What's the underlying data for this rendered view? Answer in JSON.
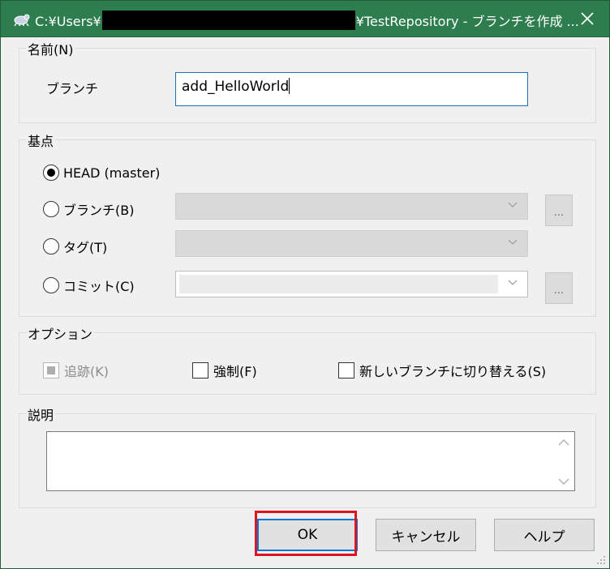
{
  "window": {
    "title_prefix": "C:¥Users¥",
    "title_suffix": "¥TestRepository - ブランチを作成 ...",
    "close_glyph": "✕",
    "accent": "#2e7d4f"
  },
  "name_group": {
    "label": "名前(N)",
    "branch_label": "ブランチ",
    "branch_value": "add_HelloWorld"
  },
  "base_group": {
    "label": "基点",
    "options": [
      {
        "label": "HEAD (master)",
        "selected": true
      },
      {
        "label": "ブランチ(B)",
        "selected": false
      },
      {
        "label": "タグ(T)",
        "selected": false
      },
      {
        "label": "コミット(C)",
        "selected": false
      }
    ],
    "browse_label": "..."
  },
  "options_group": {
    "label": "オプション",
    "track": {
      "label": "追跡(K)",
      "enabled": false
    },
    "force": {
      "label": "強制(F)",
      "checked": false
    },
    "switch": {
      "label": "新しいブランチに切り替える(S)",
      "checked": false
    }
  },
  "description_group": {
    "label": "説明",
    "value": ""
  },
  "buttons": {
    "ok": "OK",
    "cancel": "キャンセル",
    "help": "ヘルプ"
  },
  "highlight_color": "#e0141e"
}
